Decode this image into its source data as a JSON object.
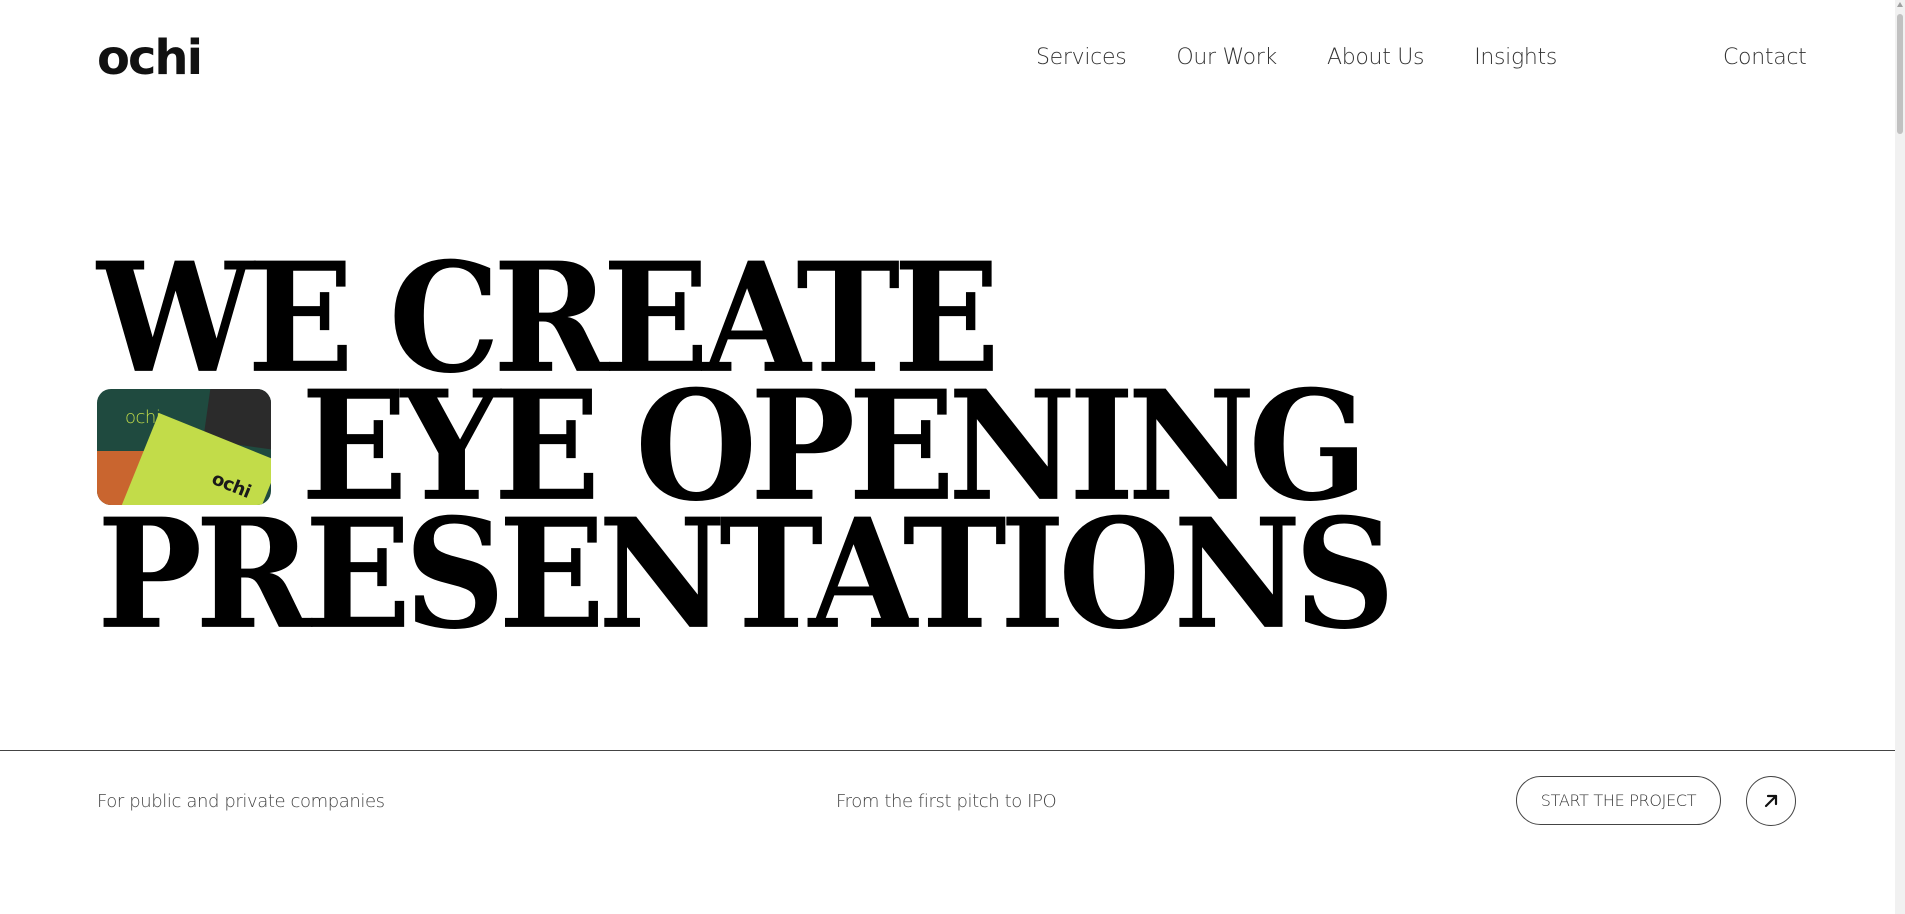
{
  "header": {
    "logo": "ochi",
    "nav": [
      {
        "label": "Services"
      },
      {
        "label": "Our Work"
      },
      {
        "label": "About Us"
      },
      {
        "label": "Insights"
      }
    ],
    "contact": "Contact"
  },
  "hero": {
    "line1": "WE CREATE",
    "line2": "EYE OPENING",
    "line3": "PRESENTATIONS",
    "thumbnail": {
      "brand_top": "ochi",
      "brand_bottom": "ochi",
      "colors": {
        "base": "#1f4a3f",
        "accent": "#c2dc49",
        "orange": "#c9652f",
        "dark": "#2b2b2b"
      }
    }
  },
  "footer_strip": {
    "left_text": "For public and private companies",
    "middle_text": "From the first pitch to IPO",
    "cta_label": "START THE PROJECT",
    "arrow_icon": "arrow-up-right-icon"
  }
}
